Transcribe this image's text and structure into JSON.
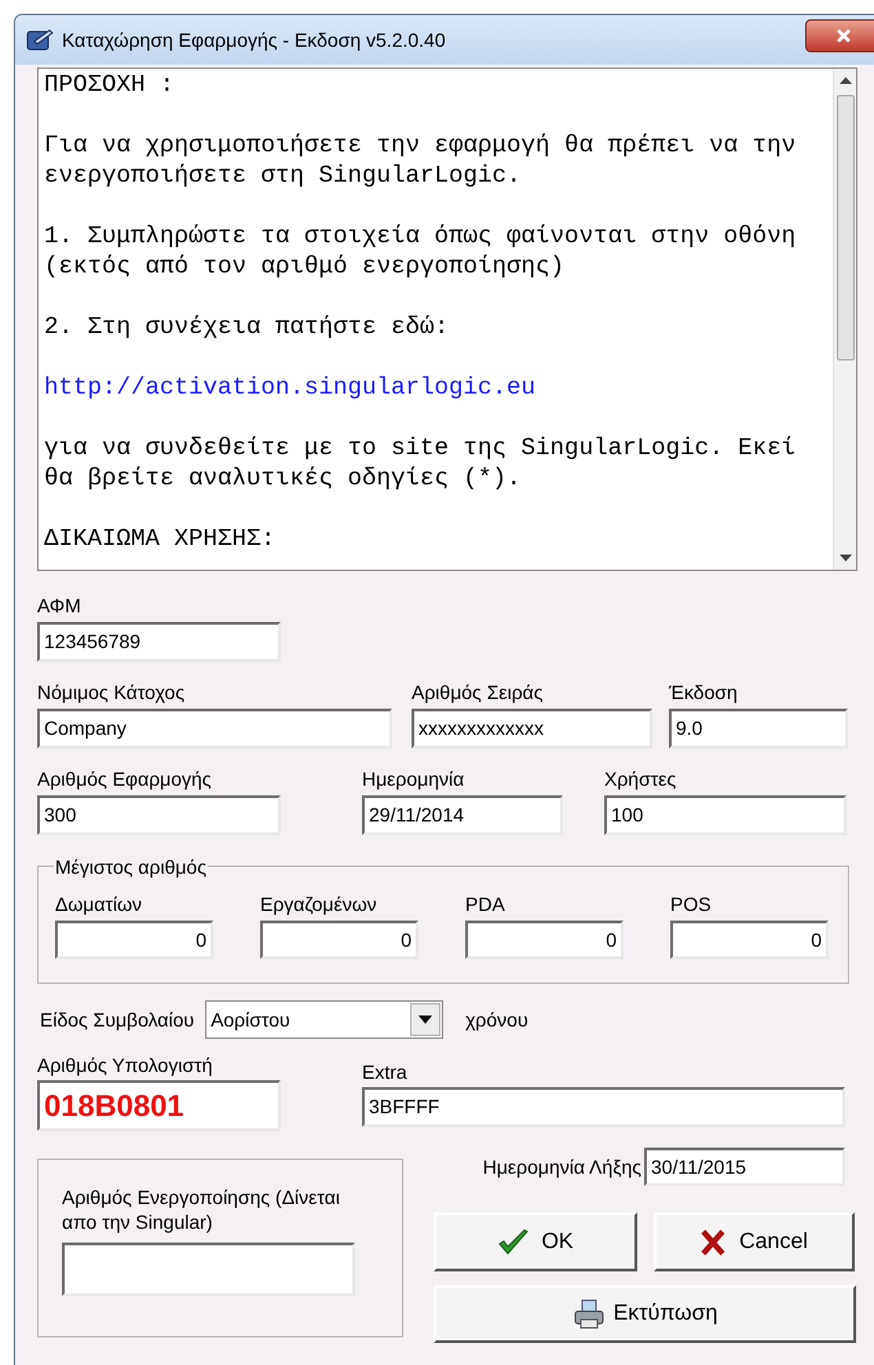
{
  "window": {
    "title": "Καταχώρηση Εφαρμογής - Εκδοση v5.2.0.40"
  },
  "notice": [
    {
      "kind": "text",
      "text": "ΠΡΟΣΟΧΗ :"
    },
    {
      "kind": "text",
      "text": "Για να χρησιμοποιήσετε την εφαρμογή θα πρέπει να την ενεργοποιήσετε στη SingularLogic."
    },
    {
      "kind": "text",
      "text": "1. Συμπληρώστε τα στοιχεία όπως φαίνονται στην οθόνη (εκτός από τον αριθμό ενεργοποίησης)"
    },
    {
      "kind": "text",
      "text": "2. Στη συνέχεια πατήστε εδώ:"
    },
    {
      "kind": "link",
      "text": "http://activation.singularlogic.eu"
    },
    {
      "kind": "text",
      "text": "για να συνδεθείτε με το site της SingularLogic. Εκεί θα βρείτε αναλυτικές οδηγίες (*)."
    },
    {
      "kind": "text",
      "text": "ΔΙΚΑΙΩΜΑ ΧΡΗΣΗΣ:"
    }
  ],
  "afm": {
    "label": "ΑΦΜ",
    "value": "123456789"
  },
  "owner": {
    "label": "Νόμιμος Κάτοχος",
    "value": "Company"
  },
  "serial": {
    "label": "Αριθμός Σειράς",
    "value": "xxxxxxxxxxxxx"
  },
  "version": {
    "label": "Έκδοση",
    "value": "9.0"
  },
  "app_number": {
    "label": "Αριθμός Εφαρμογής",
    "value": "300"
  },
  "date": {
    "label": "Ημερομηνία",
    "value": "29/11/2014"
  },
  "users": {
    "label": "Χρήστες",
    "value": "100"
  },
  "maximum": {
    "title": "Μέγιστος αριθμός",
    "fields": [
      {
        "label": "Δωματίων",
        "value": "0"
      },
      {
        "label": "Εργαζομένων",
        "value": "0"
      },
      {
        "label": "PDA",
        "value": "0"
      },
      {
        "label": "POS",
        "value": "0"
      }
    ]
  },
  "contract": {
    "label": "Είδος Συμβολαίου",
    "value": "Αορίστου",
    "suffix": "χρόνου"
  },
  "computer_number": {
    "label": "Αριθμός Υπολογιστή",
    "value": "018B0801"
  },
  "extra": {
    "label": "Extra",
    "value": "3BFFFF"
  },
  "activation": {
    "label": "Αριθμός Ενεργοποίησης (Δίνεται απο την Singular)"
  },
  "expiry": {
    "label": "Ημερομηνία Λήξης",
    "value": "30/11/2015"
  },
  "buttons": {
    "ok": "OK",
    "cancel": "Cancel",
    "print": "Εκτύπωση"
  }
}
